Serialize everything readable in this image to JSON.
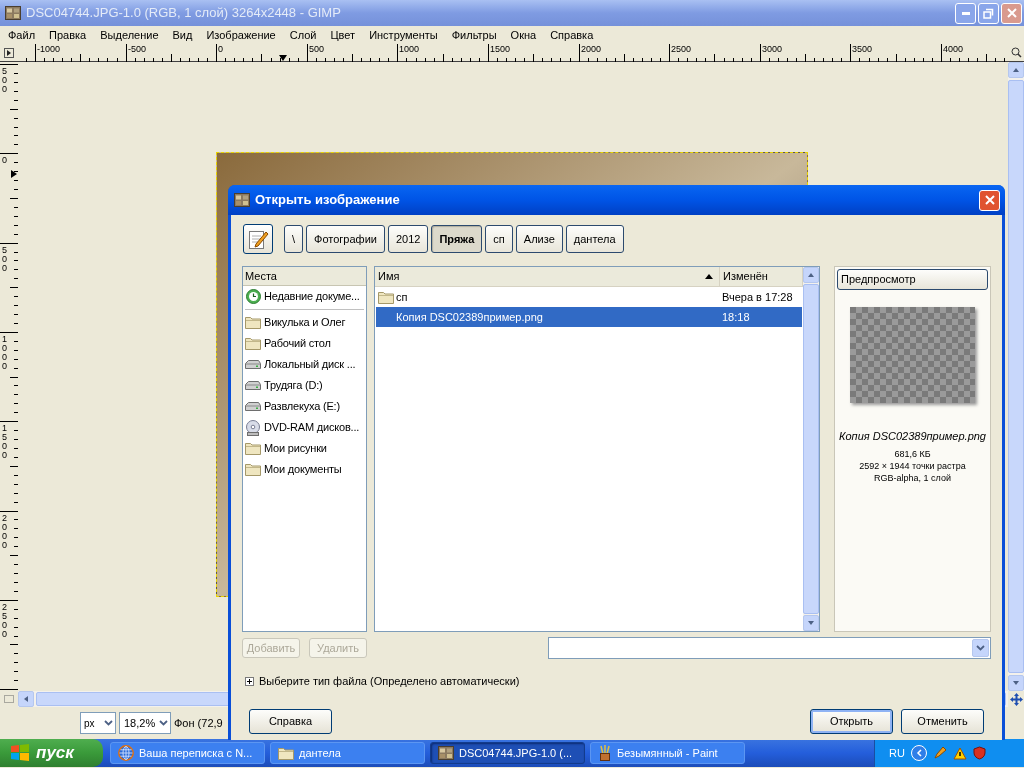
{
  "window": {
    "title": "DSC04744.JPG-1.0 (RGB, 1 слой) 3264x2448 - GIMP",
    "active": false
  },
  "menu": [
    "Файл",
    "Правка",
    "Выделение",
    "Вид",
    "Изображение",
    "Слой",
    "Цвет",
    "Инструменты",
    "Фильтры",
    "Окна",
    "Справка"
  ],
  "rulers": {
    "horizontal": [
      "-1000",
      "-500",
      "0",
      "500",
      "1000",
      "1500",
      "2000",
      "2500",
      "3000",
      "3500",
      "4000"
    ],
    "vertical": [
      "500",
      "0",
      "500",
      "1000",
      "1500",
      "2000",
      "2500"
    ]
  },
  "status_bar": {
    "unit": "px",
    "zoom": "18,2%",
    "layer": "Фон (72,9"
  },
  "dialog": {
    "title": "Открыть изображение",
    "active": true,
    "path": [
      {
        "label": "\\",
        "selected": false
      },
      {
        "label": "Фотографии",
        "selected": false
      },
      {
        "label": "2012",
        "selected": false
      },
      {
        "label": "Пряжа",
        "selected": true
      },
      {
        "label": "сп",
        "selected": false
      },
      {
        "label": "Ализе",
        "selected": false
      },
      {
        "label": "дантела",
        "selected": false
      }
    ],
    "places": {
      "header": "Места",
      "groups": [
        [
          {
            "label": "Недавние докуме...",
            "kind": "recent"
          }
        ],
        [
          {
            "label": "Викулька и Олег",
            "kind": "folder"
          },
          {
            "label": "Рабочий стол",
            "kind": "folder"
          },
          {
            "label": "Локальный диск ...",
            "kind": "drive"
          },
          {
            "label": "Трудяга (D:)",
            "kind": "drive"
          },
          {
            "label": "Развлекуха (E:)",
            "kind": "drive"
          },
          {
            "label": "DVD-RAM дисков...",
            "kind": "optical"
          },
          {
            "label": "Мои рисунки",
            "kind": "folder"
          },
          {
            "label": "Мои документы",
            "kind": "folder"
          }
        ]
      ]
    },
    "places_buttons": [
      {
        "label": "Добавить",
        "disabled": true
      },
      {
        "label": "Удалить",
        "disabled": true
      }
    ],
    "files": {
      "columns": [
        {
          "label": "Имя",
          "sorted": true
        },
        {
          "label": "Изменён",
          "sorted": false
        }
      ],
      "rows": [
        {
          "name": "сп",
          "modified": "Вчера в 17:28",
          "kind": "folder",
          "selected": false
        },
        {
          "name": "Копия DSC02389пример.png",
          "modified": "18:18",
          "kind": "file",
          "selected": true
        }
      ]
    },
    "preview": {
      "button": "Предпросмотр",
      "filename": "Копия DSC02389пример.png",
      "size": "681,6 КБ",
      "dimensions": "2592 × 1944 точки растра",
      "mode": "RGB-alpha, 1 слой"
    },
    "file_type": {
      "label": "Выберите тип файла (Определено автоматически)",
      "expanded": false
    },
    "buttons": [
      {
        "label": "Справка",
        "default": false
      },
      {
        "label": "Открыть",
        "default": true
      },
      {
        "label": "Отменить",
        "default": false
      }
    ]
  },
  "taskbar": {
    "start": "пуск",
    "tasks": [
      {
        "label": "Ваша переписка с N...",
        "kind": "browser",
        "selected": false
      },
      {
        "label": "дантела",
        "kind": "folder",
        "selected": false
      },
      {
        "label": "DSC04744.JPG-1.0 (...",
        "kind": "gimp",
        "selected": true
      },
      {
        "label": "Безымянный - Paint",
        "kind": "paint",
        "selected": false
      }
    ],
    "language": "RU"
  }
}
